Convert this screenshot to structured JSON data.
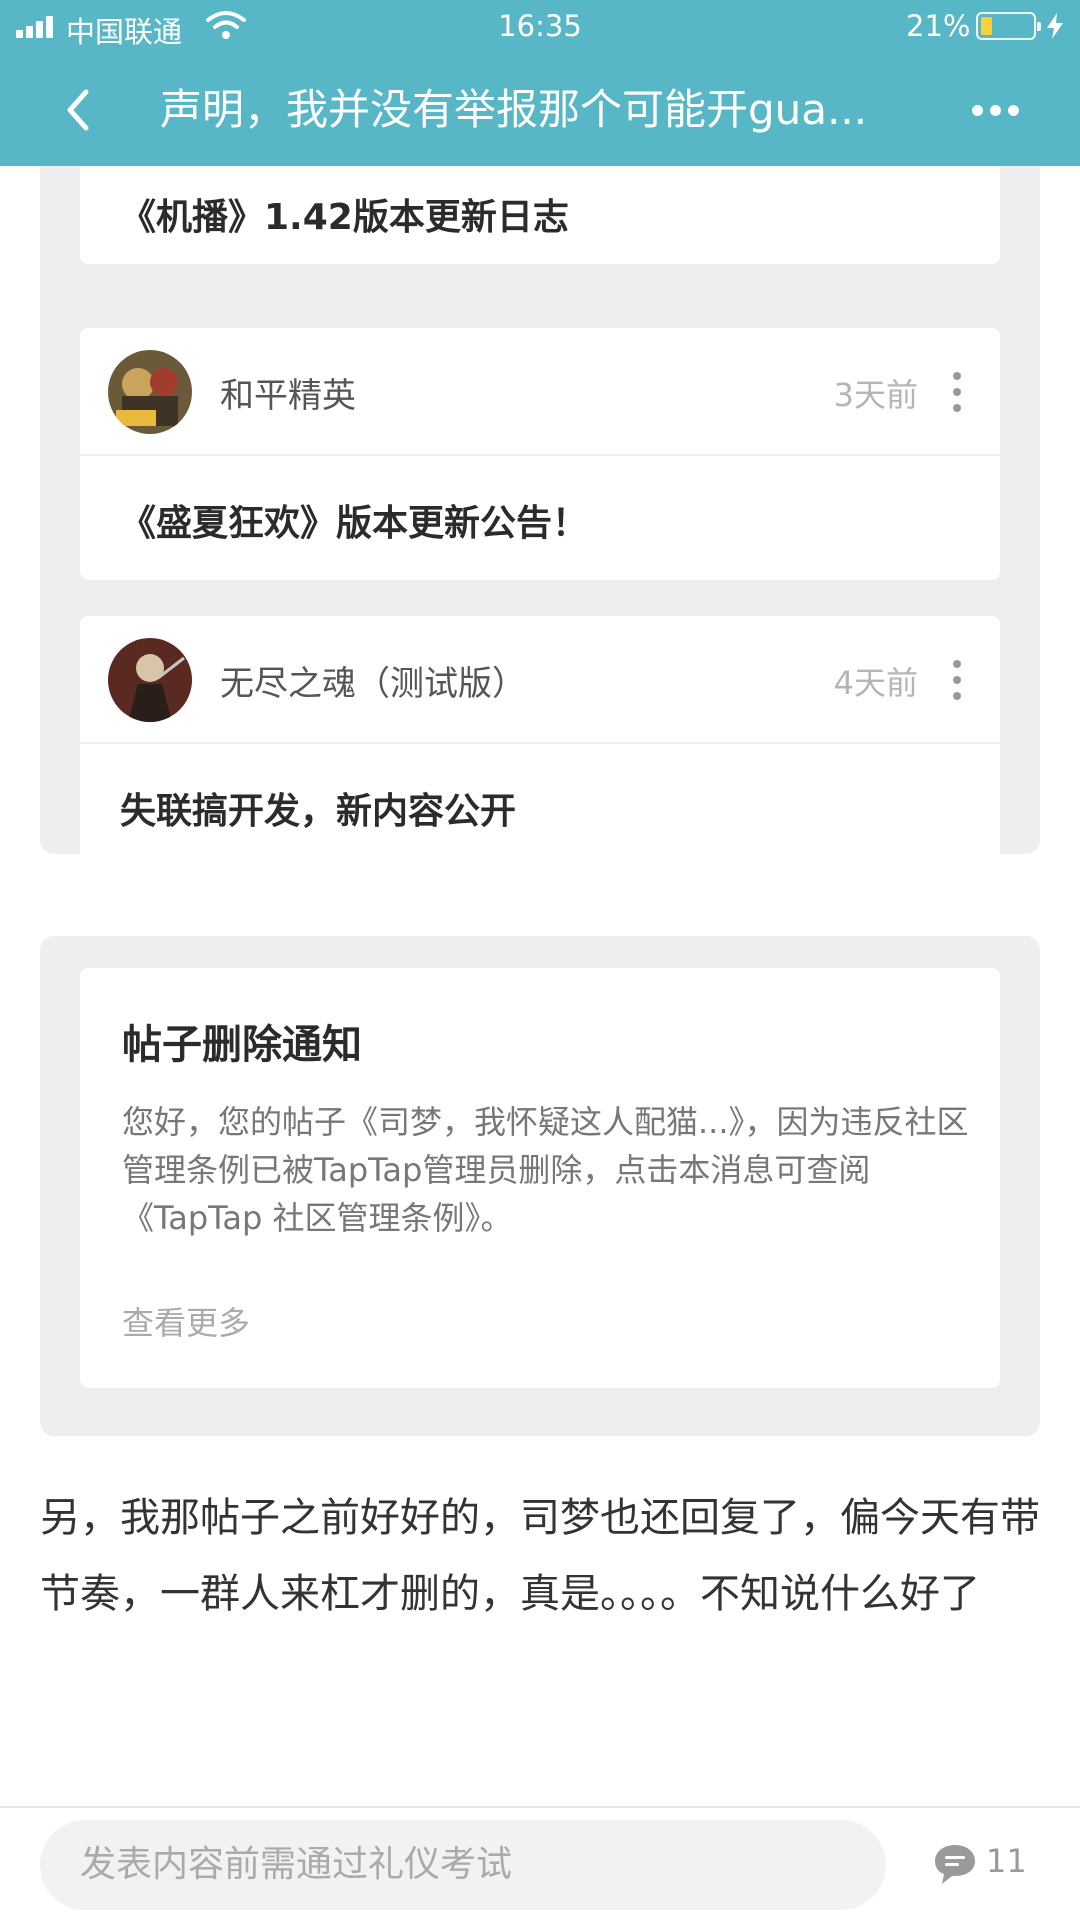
{
  "status_bar": {
    "carrier": "中国联通",
    "time": "16:35",
    "battery": "21%"
  },
  "header": {
    "title": "声明，我并没有举报那个可能开gua..."
  },
  "feed": {
    "top_card_title": "《机播》1.42版本更新日志",
    "items": [
      {
        "game": "和平精英",
        "time": "3天前",
        "title": "《盛夏狂欢》版本更新公告！"
      },
      {
        "game": "无尽之魂（测试版）",
        "time": "4天前",
        "title": "失联搞开发，新内容公开"
      }
    ]
  },
  "notice": {
    "title": "帖子删除通知",
    "body": "您好，您的帖子《司梦，我怀疑这人配猫...》，因为违反社区管理条例已被TapTap管理员删除，点击本消息可查阅《TapTap 社区管理条例》。",
    "more": "查看更多"
  },
  "post_body": "另，我那帖子之前好好的，司梦也还回复了，偏今天有带节奏，一群人来杠才删的，真是。。。。不知说什么好了",
  "bottom_bar": {
    "input_placeholder": "发表内容前需通过礼仪考试",
    "comment_count": "11"
  },
  "colors": {
    "header_bg": "#58B7C6",
    "panel_bg": "#EEEEEE",
    "battery_fill": "#F8D23A"
  }
}
